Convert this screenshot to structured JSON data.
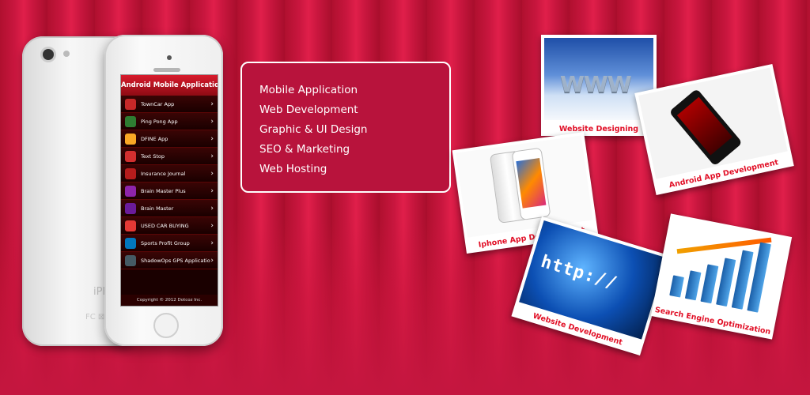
{
  "services": {
    "items": [
      "Mobile Application",
      "Web Development",
      "Graphic & UI Design",
      "SEO & Marketing",
      "Web Hosting"
    ]
  },
  "phone": {
    "brand_text": "iPhone",
    "certification_text": "FC ⊠ CE",
    "app": {
      "header": "Android Mobile Application",
      "items": [
        {
          "label": "TownCar App",
          "color": "#c62828"
        },
        {
          "label": "Ping Pong App",
          "color": "#2e7d32"
        },
        {
          "label": "DFINE App",
          "color": "#f9a825"
        },
        {
          "label": "Text Stop",
          "color": "#d32f2f"
        },
        {
          "label": "Insurance Journal",
          "color": "#b71c1c"
        },
        {
          "label": "Brain Master Plus",
          "color": "#8e24aa"
        },
        {
          "label": "Brain Master",
          "color": "#6a1b9a"
        },
        {
          "label": "USED CAR BUYING",
          "color": "#e53935"
        },
        {
          "label": "Sports Profit Group",
          "color": "#0277bd"
        },
        {
          "label": "ShadowOps GPS Application",
          "color": "#455a64"
        }
      ],
      "footer": "Copyright © 2012 Dotcoz Inc."
    }
  },
  "cards": {
    "website_designing": {
      "caption": "Website Designing",
      "image_text": "WWW"
    },
    "android_app": {
      "caption": "Android App Development"
    },
    "iphone_app": {
      "caption": "Iphone App Development"
    },
    "website_development": {
      "caption": "Website Development",
      "image_text": "http://"
    },
    "seo": {
      "caption": "Search Engine Optimization"
    }
  },
  "colors": {
    "brand_red": "#c8163e",
    "caption_red": "#e10f26"
  }
}
